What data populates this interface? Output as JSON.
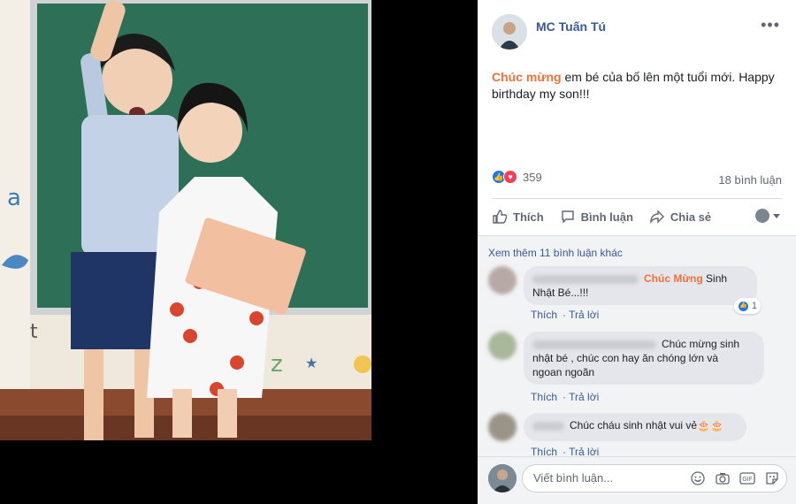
{
  "post": {
    "author": "MC Tuấn Tú",
    "more_label": "•••",
    "caption_highlight": "Chúc mừng",
    "caption_rest": " em bé của bố lên một tuổi mới. Happy birthday my son!!!",
    "reaction_count": "359",
    "comment_count": "18 bình luận"
  },
  "actions": {
    "like": "Thích",
    "comment": "Bình luận",
    "share": "Chia sẻ"
  },
  "comments": {
    "see_more": "Xem thêm 11 bình luận khác",
    "like_label": "Thích",
    "reply_label": "Trả lời",
    "items": [
      {
        "highlight": "Chúc Mừng",
        "text_after": " Sinh",
        "line2": "Nhật Bé...!!!",
        "reactions": "1"
      },
      {
        "text": "Chúc mừng sinh",
        "line2": "nhật bé , chúc con hay ăn chóng lớn và",
        "line3": "ngoan ngoãn"
      },
      {
        "text": "Chúc cháu sinh nhật vui vẻ🎂🎂"
      }
    ]
  },
  "composer": {
    "placeholder": "Viết bình luận..."
  },
  "colors": {
    "brand_link": "#385898",
    "highlight": "#f0703a",
    "like_blue": "#1877f2",
    "love_red": "#f33e58"
  },
  "icons": [
    "like-icon",
    "comment-icon",
    "share-icon",
    "emoji-icon",
    "camera-icon",
    "gif-icon",
    "sticker-icon",
    "more-icon"
  ]
}
